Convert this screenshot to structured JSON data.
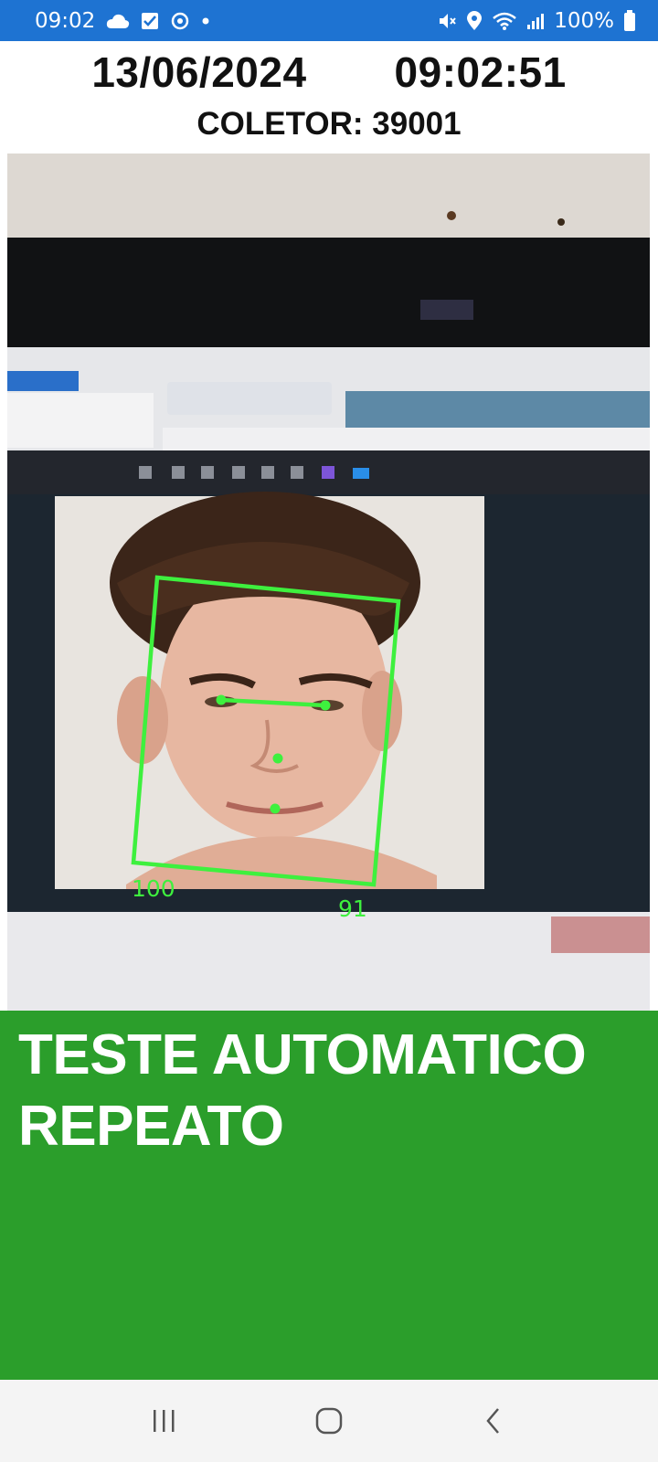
{
  "status_bar": {
    "time": "09:02",
    "battery": "100%",
    "left_icons": [
      "cloud-icon",
      "checkbox-icon",
      "sync-icon",
      "dot-icon"
    ],
    "right_icons": [
      "mute-icon",
      "location-icon",
      "wifi-icon",
      "signal-icon",
      "battery-icon"
    ]
  },
  "header": {
    "date": "13/06/2024",
    "time": "09:02:51",
    "collector": "COLETOR: 39001"
  },
  "camera": {
    "face_detection": {
      "color": "#3ef03e",
      "labels": {
        "bottom_left": "100",
        "bottom_right": "91"
      }
    }
  },
  "result": {
    "message": "TESTE AUTOMATICO\nREPEATO",
    "background": "#2b9e2b"
  },
  "nav": {
    "buttons": [
      "recent-apps-icon",
      "home-icon",
      "back-icon"
    ]
  },
  "colors": {
    "status_bar": "#1e73d2",
    "accent_green": "#3ef03e"
  }
}
